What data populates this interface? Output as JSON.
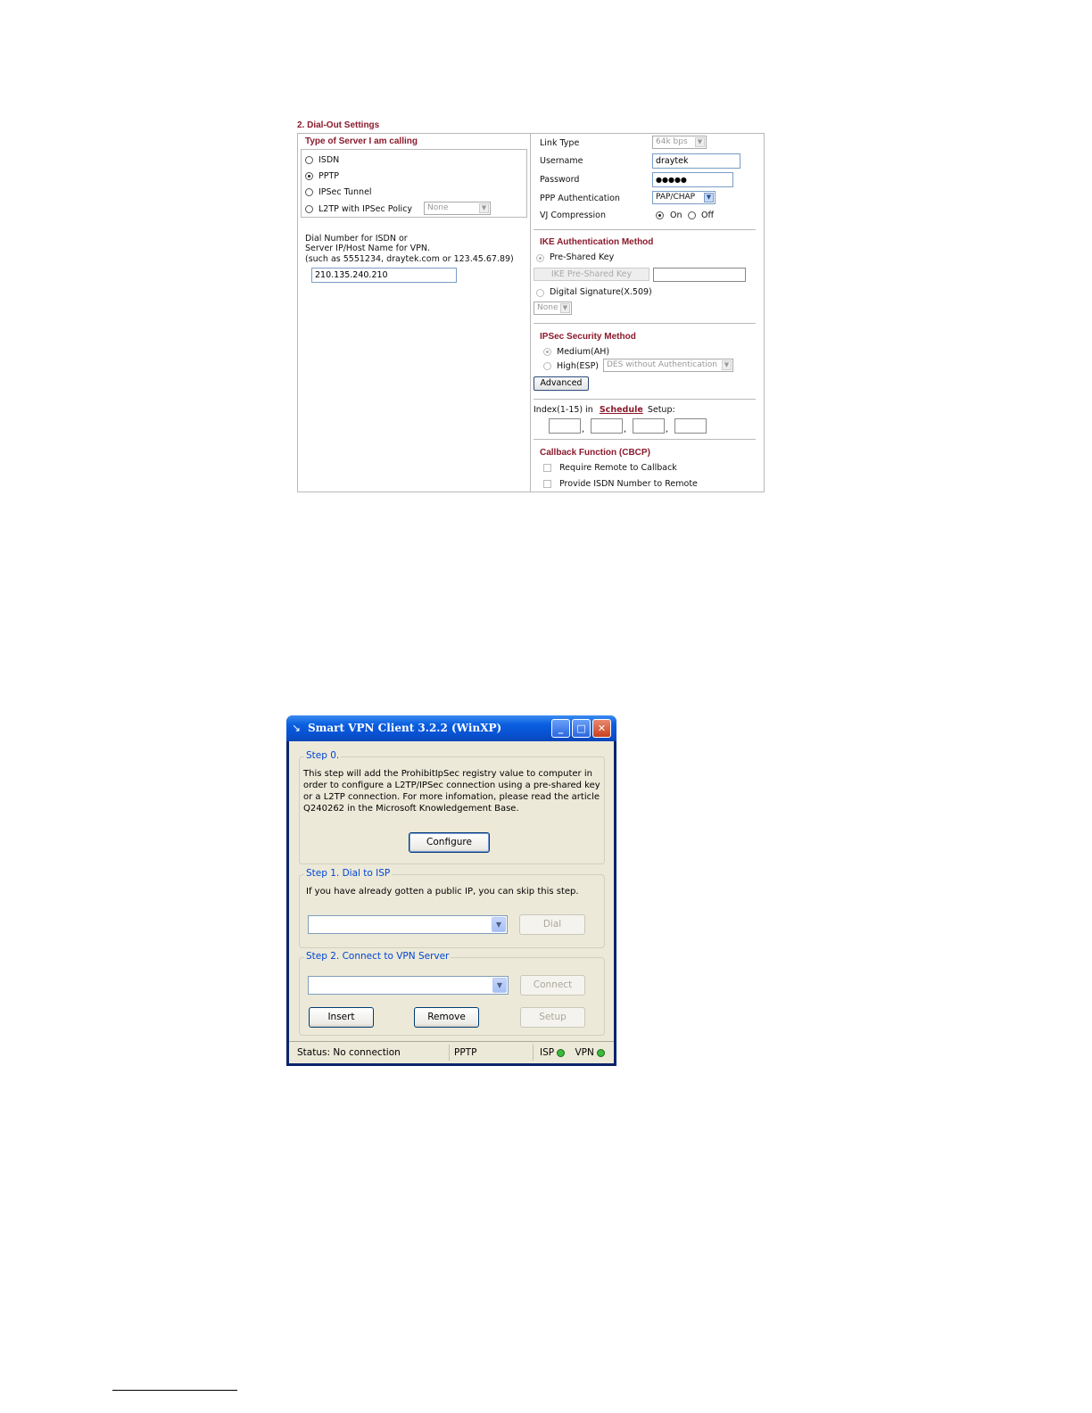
{
  "dialout": {
    "section_title": "2. Dial-Out Settings",
    "server_type_title": "Type of Server I am calling",
    "server_types": [
      "ISDN",
      "PPTP",
      "IPSec Tunnel",
      "L2TP with IPSec Policy"
    ],
    "selected_server_type": "PPTP",
    "l2tp_policy_value": "None",
    "dial_number_help": [
      "Dial Number for ISDN or",
      "Server IP/Host Name for VPN.",
      "(such as 5551234, draytek.com or 123.45.67.89)"
    ],
    "dial_number_value": "210.135.240.210",
    "link_type_label": "Link Type",
    "link_type_value": "64k bps",
    "username_label": "Username",
    "username_value": "draytek",
    "password_label": "Password",
    "password_value": "●●●●●",
    "ppp_auth_label": "PPP Authentication",
    "ppp_auth_value": "PAP/CHAP",
    "vj_label": "VJ Compression",
    "vj_on": "On",
    "vj_off": "Off",
    "vj_selected": "On",
    "ike_title": "IKE Authentication Method",
    "ike_psk_label": "Pre-Shared Key",
    "ike_psk_button": "IKE Pre-Shared Key",
    "ike_ds_label": "Digital Signature(X.509)",
    "ike_ds_value": "None",
    "ipsec_title": "IPSec Security Method",
    "ipsec_medium": "Medium(AH)",
    "ipsec_high": "High(ESP)",
    "ipsec_high_value": "DES without Authentication",
    "advanced_button": "Advanced",
    "schedule_prefix": "Index(1-15) in",
    "schedule_link": "Schedule",
    "schedule_suffix": "Setup:",
    "schedule_sep": ",",
    "callback_title": "Callback Function (CBCP)",
    "callback_require": "Require Remote to Callback",
    "callback_provide": "Provide ISDN Number to Remote"
  },
  "vpn_client": {
    "window_title": "Smart VPN Client  3.2.2 (WinXP)",
    "step0_title": "Step 0.",
    "step0_text": "This step will add the ProhibitIpSec registry value to computer in order to configure a L2TP/IPSec connection using a pre-shared key or a L2TP connection. For more infomation, please read the article Q240262 in the Microsoft Knowledgement Base.",
    "configure_button": "Configure",
    "step1_title": "Step 1. Dial to ISP",
    "step1_text": "If you have already gotten a public IP, you can skip this step.",
    "dial_button": "Dial",
    "step2_title": "Step 2. Connect to VPN Server",
    "connect_button": "Connect",
    "insert_button": "Insert",
    "remove_button": "Remove",
    "setup_button": "Setup",
    "status_text": "Status: No connection",
    "protocol_text": "PPTP",
    "isp_label": "ISP",
    "vpn_label": "VPN",
    "led_color": "#3cbb3c"
  }
}
